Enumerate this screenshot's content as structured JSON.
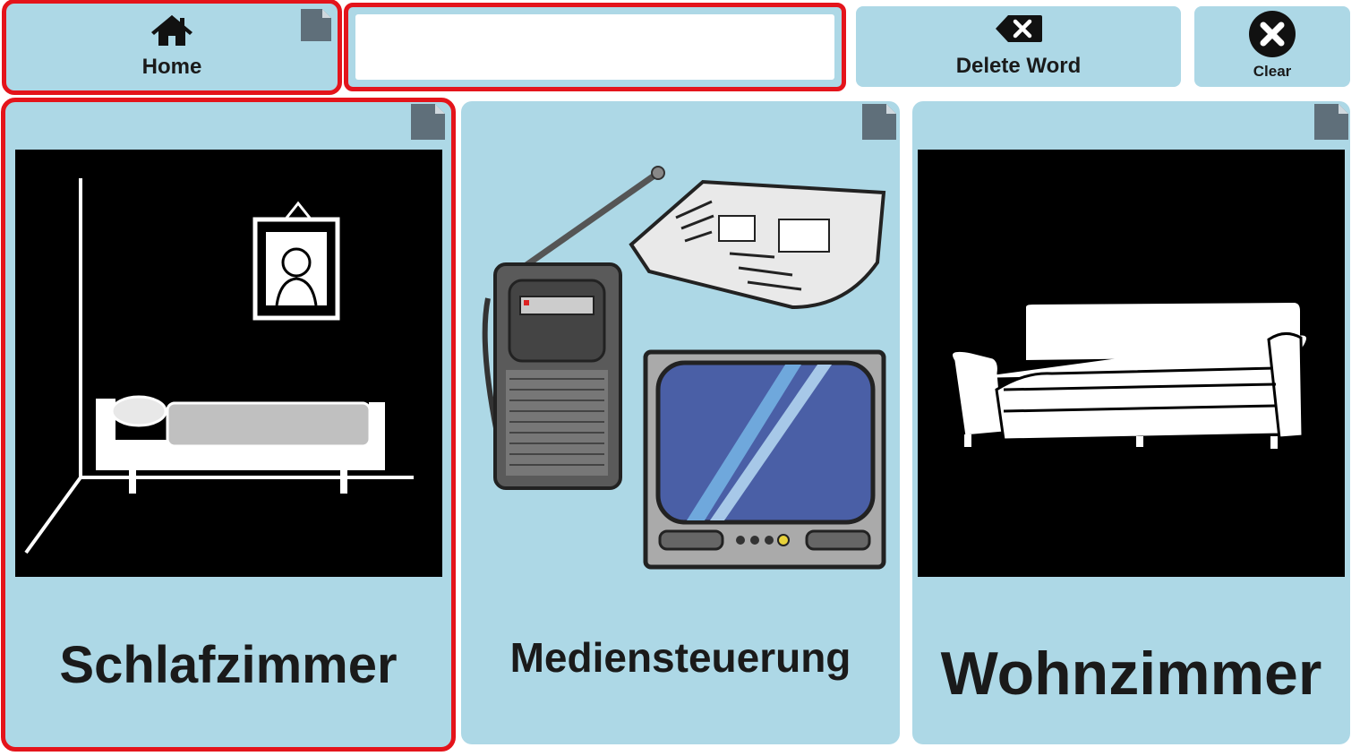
{
  "toolbar": {
    "home_label": "Home",
    "delete_word_label": "Delete Word",
    "clear_label": "Clear"
  },
  "message_bar": {
    "text": ""
  },
  "tiles": [
    {
      "label": "Schlafzimmer",
      "icon": "bedroom-picture"
    },
    {
      "label": "Mediensteuerung",
      "icon": "media-picture"
    },
    {
      "label": "Wohnzimmer",
      "icon": "sofa-picture"
    }
  ],
  "colors": {
    "tile_background": "#add8e6",
    "selection_outline": "#e4141b",
    "page_icon": "#5f6f7a"
  }
}
